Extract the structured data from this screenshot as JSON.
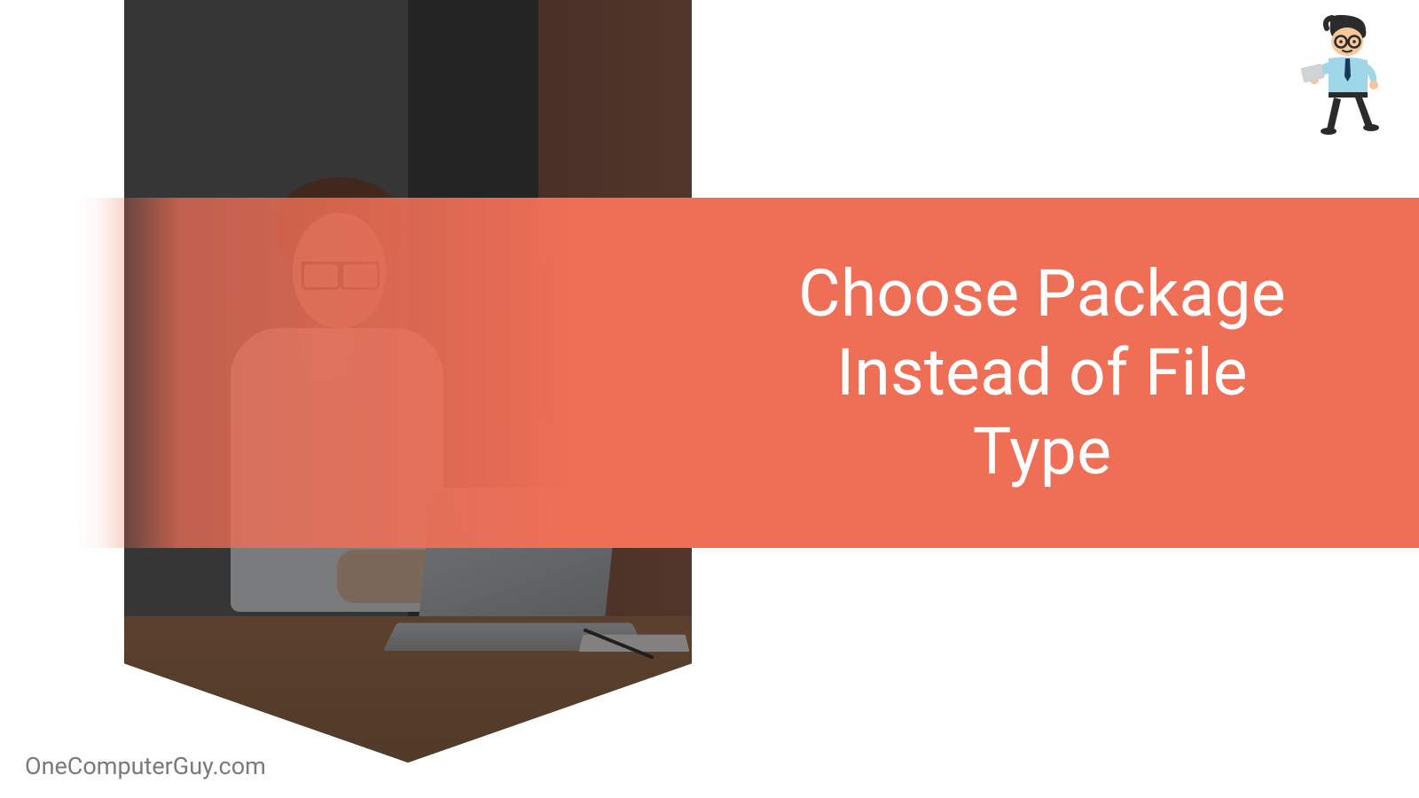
{
  "banner": {
    "title": "Choose Package Instead of File Type"
  },
  "footer": {
    "credit": "OneComputerGuy.com"
  },
  "colors": {
    "accent": "#ef6f56",
    "text_light": "#ffffff",
    "text_muted": "#7a7a7a"
  },
  "mascot": {
    "name": "computer-guy-mascot"
  }
}
